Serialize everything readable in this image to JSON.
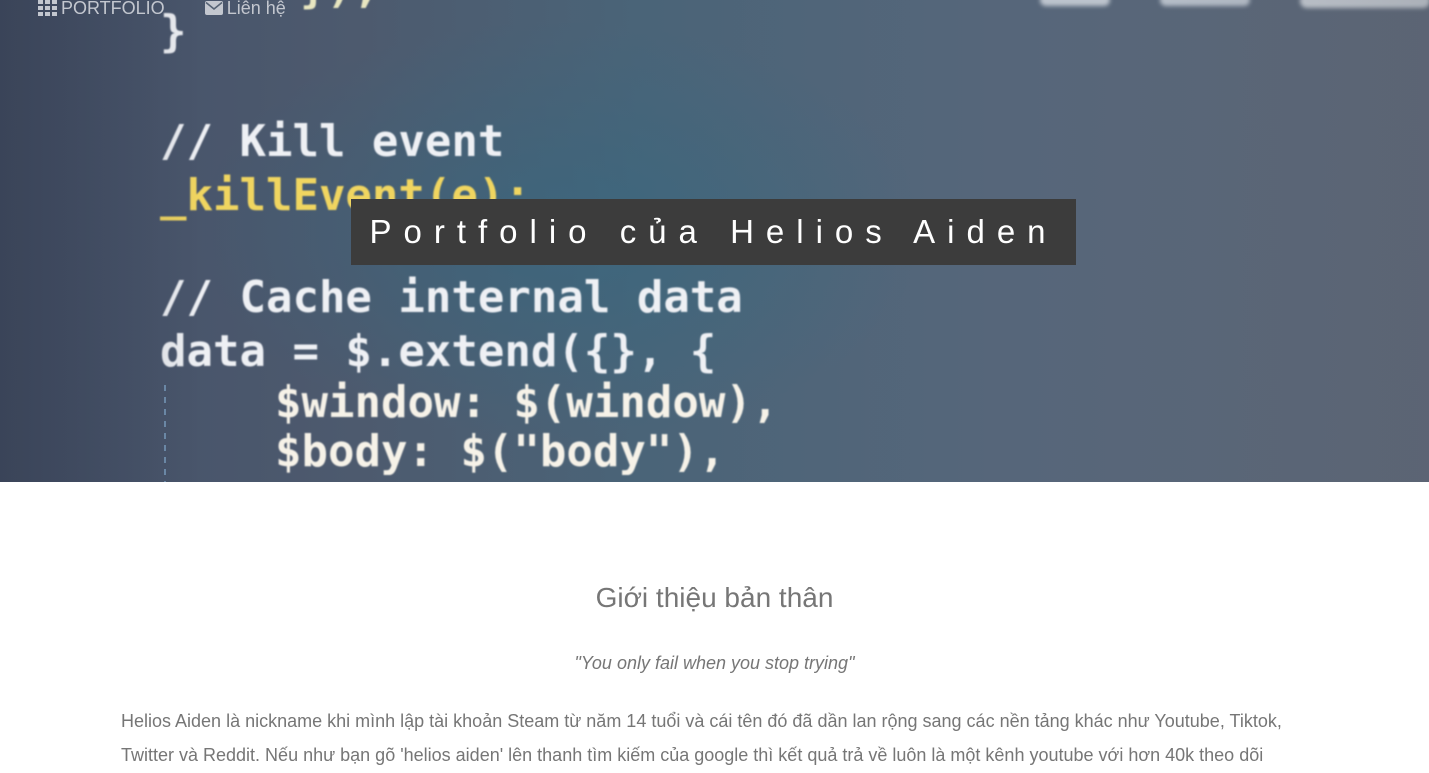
{
  "nav": {
    "portfolio_label": "PORTFOLIO",
    "contact_label": "Liên hệ"
  },
  "hero": {
    "title": "Portfolio của Helios Aiden",
    "background_code": [
      "});",
      "}",
      "// Kill event",
      "_killEvent(e);",
      "// Cache internal data",
      "data = $.extend({}, {",
      "$window: $(window),",
      "$body: $(\"body\"),"
    ]
  },
  "about": {
    "heading": "Giới thiệu bản thân",
    "quote": "\"You only fail when you stop trying\"",
    "paragraph": "Helios Aiden là nickname khi mình lập tài khoản Steam từ năm 14 tuổi và cái tên đó đã dần lan rộng sang các nền tảng khác như Youtube, Tiktok, Twitter và Reddit. Nếu như bạn gõ 'helios aiden' lên thanh tìm kiếm của google thì kết quả trả về luôn là một kênh youtube với hơn 40k theo dõi"
  },
  "colors": {
    "nav_text": "#c3c7cf",
    "title_box_bg": "#3c3c3c",
    "body_text": "#767676"
  }
}
